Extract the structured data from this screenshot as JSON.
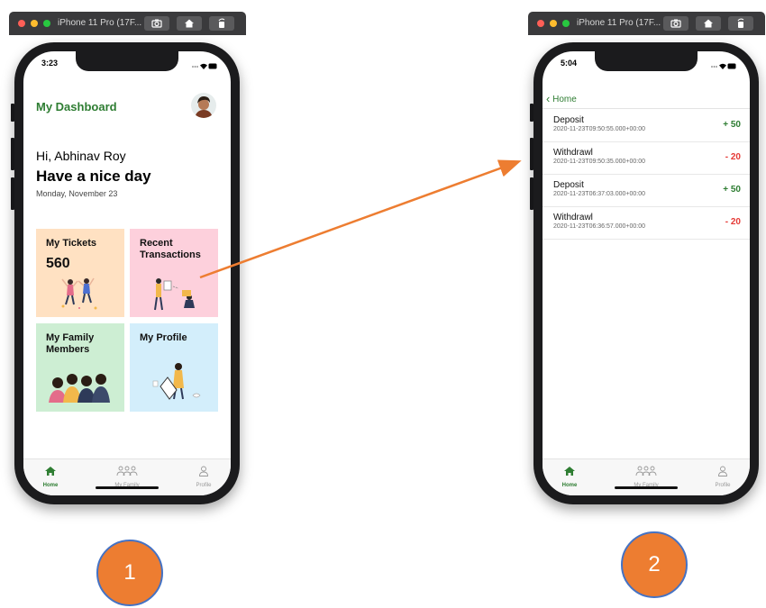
{
  "window": {
    "title": "iPhone 11 Pro (17F..."
  },
  "screen1": {
    "time": "3:23",
    "dashboard_title": "My Dashboard",
    "greeting": "Hi, Abhinav Roy",
    "subtitle": "Have a nice day",
    "date": "Monday, November 23",
    "cards": [
      {
        "title": "My Tickets",
        "value": "560",
        "color": "#ffe1c2"
      },
      {
        "title": "Recent Transactions",
        "color": "#fdd0dc"
      },
      {
        "title": "My Family Members",
        "color": "#cdeed3"
      },
      {
        "title": "My Profile",
        "color": "#d3eefb"
      }
    ]
  },
  "screen2": {
    "time": "5:04",
    "back_label": "Home",
    "transactions": [
      {
        "type": "Deposit",
        "time": "2020-11-23T09:50:55.000+00:00",
        "amount": "+ 50",
        "color": "#2e7d32"
      },
      {
        "type": "Withdrawl",
        "time": "2020-11-23T09:50:35.000+00:00",
        "amount": "- 20",
        "color": "#e53935"
      },
      {
        "type": "Deposit",
        "time": "2020-11-23T06:37:03.000+00:00",
        "amount": "+ 50",
        "color": "#2e7d32"
      },
      {
        "type": "Withdrawl",
        "time": "2020-11-23T06:36:57.000+00:00",
        "amount": "- 20",
        "color": "#e53935"
      }
    ]
  },
  "tabs": [
    {
      "label": "Home",
      "icon": "home-icon"
    },
    {
      "label": "My Family",
      "icon": "family-icon"
    },
    {
      "label": "Profile",
      "icon": "profile-icon"
    }
  ],
  "steps": [
    "1",
    "2"
  ],
  "colors": {
    "accent": "#2e7d32",
    "annotation": "#ed7d31",
    "annotation_border": "#4472c4"
  }
}
